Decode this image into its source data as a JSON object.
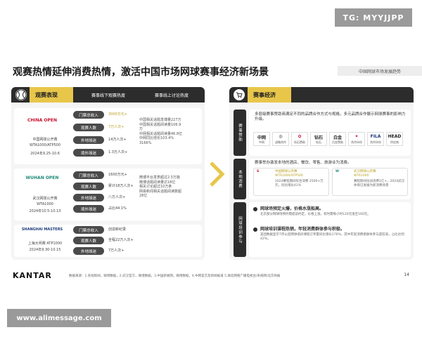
{
  "watermark_top": "TG: MYYJJPP",
  "watermark_bottom": "www.alimessage.com",
  "title": "观赛热情延伸消费热情，激活中国市场网球赛事经济新场景",
  "tagline": "中国网球市场发展趋势",
  "left": {
    "header": "观赛表现",
    "col1": "赛事线下观赛热度",
    "col2": "赛事线上讨论热度",
    "chips": [
      "门票总收入",
      "观赛人数",
      "外地球迷",
      "境外球迷"
    ],
    "events": [
      {
        "logo": "CHINA OPEN",
        "name": "中国网球公开赛",
        "level": "WTA1000/ATP500",
        "date": "2024年9.25-10.6",
        "values": [
          "3000万元+",
          "7万人次+",
          "14万人次+",
          "1.3万人次+"
        ],
        "bullets": "中国相关话题发博量227万\n中国相关话题阅读量106.9万\n中网相关话题阅读量46.8亿\n中网同比增长103.4%\n3166%"
      },
      {
        "logo": "WUHAN OPEN",
        "name": "武汉网球公开赛",
        "level": "WTA1000",
        "date": "2024年10.5-10.13",
        "values": [
          "1600万元+",
          "累计18万人次+",
          "八万人次+",
          "占比44.1%"
        ],
        "bullets": "微博平台发表超过2.5万篇\n微博话题阅读量达18亿\n相关讨论超过10万条\n网易新闻相关话题阅读数超28亿"
      },
      {
        "logo": "SHANGHAI MASTERS",
        "name": "上海大师赛 ATP1000",
        "date": "2024年9.30-10.15",
        "values": [
          "创造新纪录",
          "全程22万人次+",
          "7万人次+"
        ]
      }
    ]
  },
  "right": {
    "header": "赛事经济",
    "sections": [
      "赛事赞助",
      "本地消费",
      "网球培训参与"
    ],
    "sponsor_text": "多层级赛事赞助商满足不同的品牌合作方式与规格，多元品牌合作展示网球赛事的影响力升级。",
    "sponsors": [
      {
        "mark": "中网",
        "label": "中网"
      },
      {
        "mark": "◎",
        "label": "战略合作"
      },
      {
        "mark": "✿",
        "label": "钻石赞助"
      },
      {
        "mark": "钻石",
        "label": "钻石"
      },
      {
        "mark": "白金",
        "label": "白金赞助"
      },
      {
        "mark": "✦",
        "label": "合作伙伴"
      },
      {
        "mark": "FILA",
        "label": "合作伙伴"
      },
      {
        "mark": "HEAD",
        "label": "供应商"
      }
    ],
    "local_text": "赛事举办激发本地的酒店、餐饮、零售、旅游业为消费。",
    "local_cards": [
      {
        "name": "中国网球公开赛",
        "level": "WTA1000/ATP500",
        "detail": "2024赛程期间综合消费 2500+万元，同比增长41%"
      },
      {
        "name": "武汉网球公开赛",
        "level": "WTA1000",
        "detail": "赛程期间拉动消费1亿+，2024武汉体育已发展为新消费场景"
      }
    ],
    "training": [
      {
        "head": "网球场预定火爆，价格水涨船高。",
        "sub": "北京部分网球场预约需提前约定，价格上涨，有时需每小时120元涨至160元。"
      },
      {
        "head": "网球培训课程热销，年轻消费群体参与积极。",
        "sub": "美团数据显示7月以后网球培训课程订单量同比增长176%，其中年轻消费者群体参与度较高，占比达到42%。"
      }
    ]
  },
  "footer": {
    "brand": "KANTAR",
    "source": "数据来源：1.央视新闻，微博数据，2.武汉官方，微博数据，3.中国新闻网，微博数据，4.中网官方及新闻报道 5.湖北网络广播电视台/央视网/北京商报",
    "page": "14"
  }
}
